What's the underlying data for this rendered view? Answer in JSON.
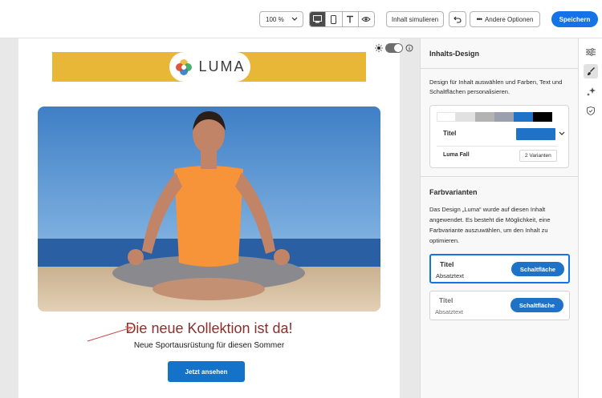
{
  "toolbar": {
    "zoom": "100 %",
    "simulate_label": "Inhalt simulieren",
    "more_label": "Andere Optionen",
    "save_label": "Speichern"
  },
  "email": {
    "logo_text": "LUMA",
    "headline": "Die neue Kollektion ist da!",
    "subheadline": "Neue Sportausrüstung für diesen Sommer",
    "cta_label": "Jetzt ansehen"
  },
  "panel": {
    "title": "Inhalts-Design",
    "description": "Design für Inhalt auswählen und Farben, Text und Schaltflächen personalisieren.",
    "design_card": {
      "swatches": [
        "#ffffff",
        "#e1e1e1",
        "#b3b3b3",
        "#9aa0ad",
        "#1e73c8",
        "#000000"
      ],
      "title": "Titel",
      "name": "Luma Fall",
      "variants": "2 Varianten"
    },
    "section_title": "Farbvarianten",
    "section_description": "Das Design „Luma“ wurde auf diesen Inhalt angewendet. Es besteht die Möglichkeit, eine Farbvariante auszuwählen, um den Inhalt zu optimieren.",
    "variants": [
      {
        "title": "Titel",
        "text": "Absatztext",
        "button": "Schaltfläche"
      },
      {
        "title": "Titel",
        "text": "Absatztext",
        "button": "Schaltfläche"
      }
    ]
  },
  "colors": {
    "accent": "#1473e6",
    "logo_bar": "#e9b737",
    "headline": "#8c2f2a"
  }
}
